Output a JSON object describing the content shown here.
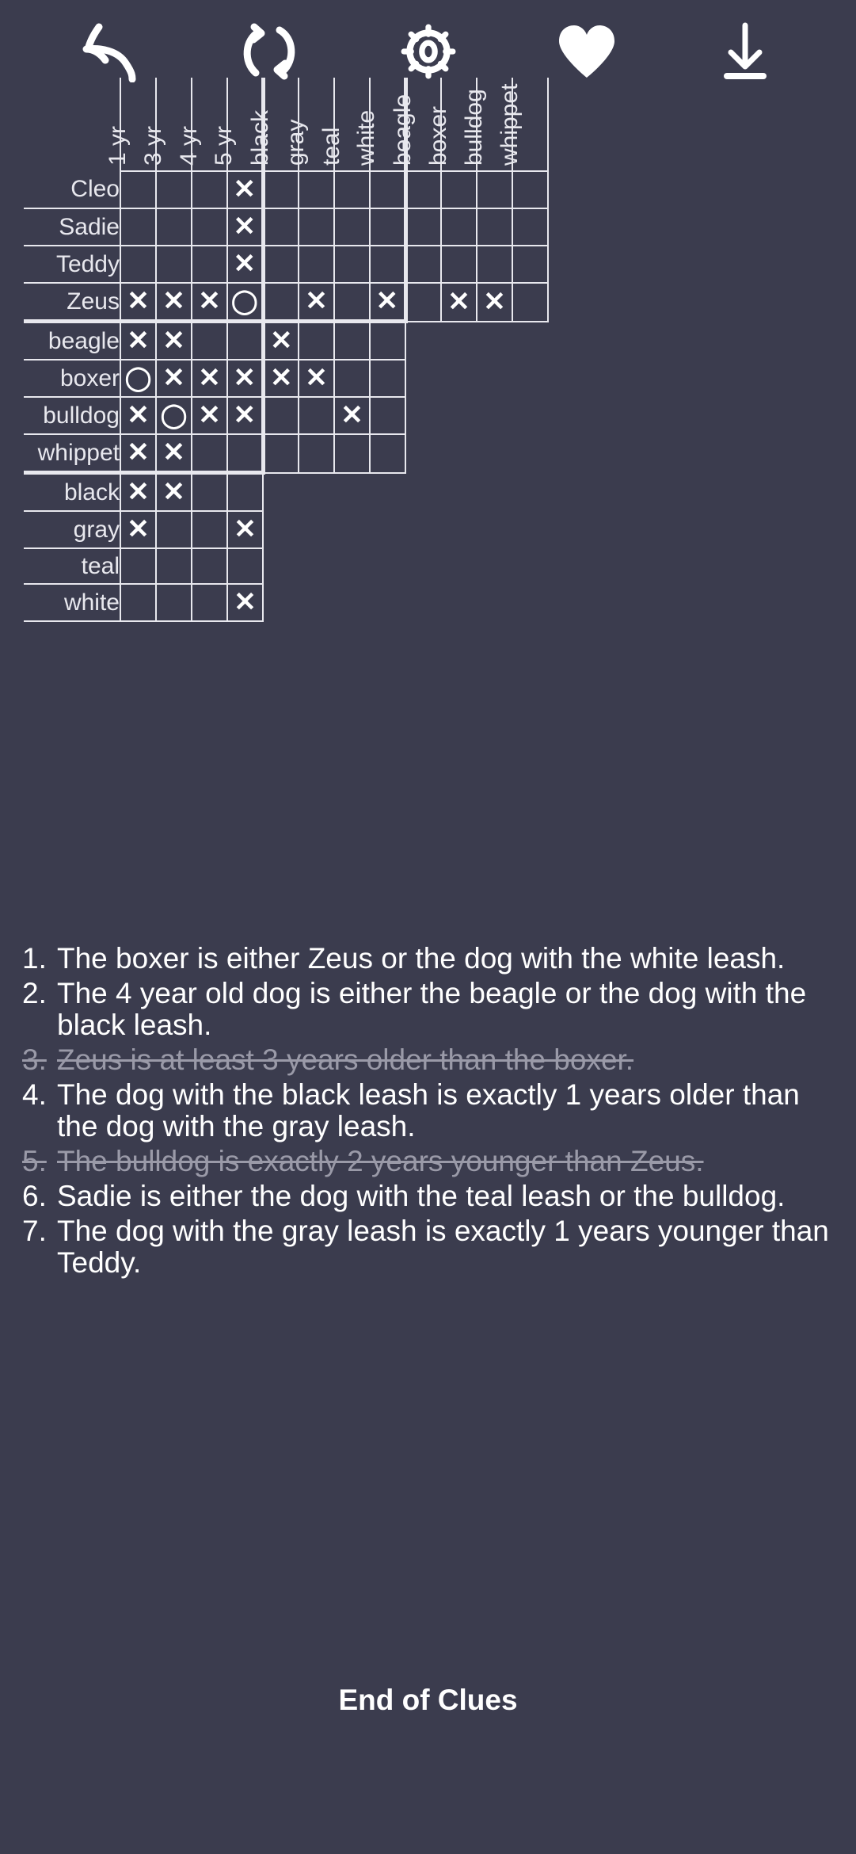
{
  "toolbar": {
    "buttons": [
      {
        "name": "undo-icon",
        "label": "Undo"
      },
      {
        "name": "restart-icon",
        "label": "Restart"
      },
      {
        "name": "gear-icon",
        "label": "Settings"
      },
      {
        "name": "heart-icon",
        "label": "Favorite"
      },
      {
        "name": "download-icon",
        "label": "Download"
      }
    ]
  },
  "grid": {
    "col_groups": [
      {
        "name": "age",
        "headers": [
          "1 yr",
          "3 yr",
          "4 yr",
          "5 yr"
        ]
      },
      {
        "name": "leash",
        "headers": [
          "black",
          "gray",
          "teal",
          "white"
        ]
      },
      {
        "name": "breed",
        "headers": [
          "beagle",
          "boxer",
          "bulldog",
          "whippet"
        ]
      }
    ],
    "row_groups": [
      {
        "name": "names",
        "rows": [
          {
            "label": "Cleo",
            "cells": [
              "",
              "",
              "",
              "X",
              "",
              "",
              "",
              "",
              "",
              "",
              "",
              ""
            ]
          },
          {
            "label": "Sadie",
            "cells": [
              "",
              "",
              "",
              "X",
              "",
              "",
              "",
              "",
              "",
              "",
              "",
              ""
            ]
          },
          {
            "label": "Teddy",
            "cells": [
              "",
              "",
              "",
              "X",
              "",
              "",
              "",
              "",
              "",
              "",
              "",
              ""
            ]
          },
          {
            "label": "Zeus",
            "cells": [
              "X",
              "X",
              "X",
              "O",
              "",
              "X",
              "",
              "X",
              "",
              "X",
              "X",
              ""
            ]
          }
        ]
      },
      {
        "name": "breeds",
        "rows": [
          {
            "label": "beagle",
            "cells": [
              "X",
              "X",
              "",
              "",
              "X",
              "",
              "",
              ""
            ]
          },
          {
            "label": "boxer",
            "cells": [
              "O",
              "X",
              "X",
              "X",
              "X",
              "X",
              "",
              ""
            ]
          },
          {
            "label": "bulldog",
            "cells": [
              "X",
              "O",
              "X",
              "X",
              "",
              "",
              "X",
              ""
            ]
          },
          {
            "label": "whippet",
            "cells": [
              "X",
              "X",
              "",
              "",
              "",
              "",
              "",
              ""
            ]
          }
        ]
      },
      {
        "name": "leashes",
        "rows": [
          {
            "label": "black",
            "cells": [
              "X",
              "X",
              "",
              ""
            ]
          },
          {
            "label": "gray",
            "cells": [
              "X",
              "",
              "",
              "X"
            ]
          },
          {
            "label": "teal",
            "cells": [
              "",
              "",
              "",
              ""
            ]
          },
          {
            "label": "white",
            "cells": [
              "",
              "",
              "",
              "X"
            ]
          }
        ]
      }
    ]
  },
  "clues": {
    "items": [
      {
        "num": "1.",
        "text": "The boxer is either Zeus or the dog with the white leash.",
        "solved": false
      },
      {
        "num": "2.",
        "text": "The 4 year old dog is either the beagle or the dog with the black leash.",
        "solved": false
      },
      {
        "num": "3.",
        "text": "Zeus is at least 3 years older than the boxer.",
        "solved": true
      },
      {
        "num": "4.",
        "text": "The dog with the black leash is exactly 1 years older than the dog with the gray leash.",
        "solved": false
      },
      {
        "num": "5.",
        "text": "The bulldog is exactly 2 years younger than Zeus.",
        "solved": true
      },
      {
        "num": "6.",
        "text": "Sadie is either the dog with the teal leash or the bulldog.",
        "solved": false
      },
      {
        "num": "7.",
        "text": "The dog with the gray leash is exactly 1 years younger than Teddy.",
        "solved": false
      }
    ],
    "end_label": "End of Clues"
  },
  "colors": {
    "background": "#3b3c4e",
    "ink": "#ffffff",
    "line": "#e8e8ee",
    "solved_text": "#9a9aa8"
  }
}
